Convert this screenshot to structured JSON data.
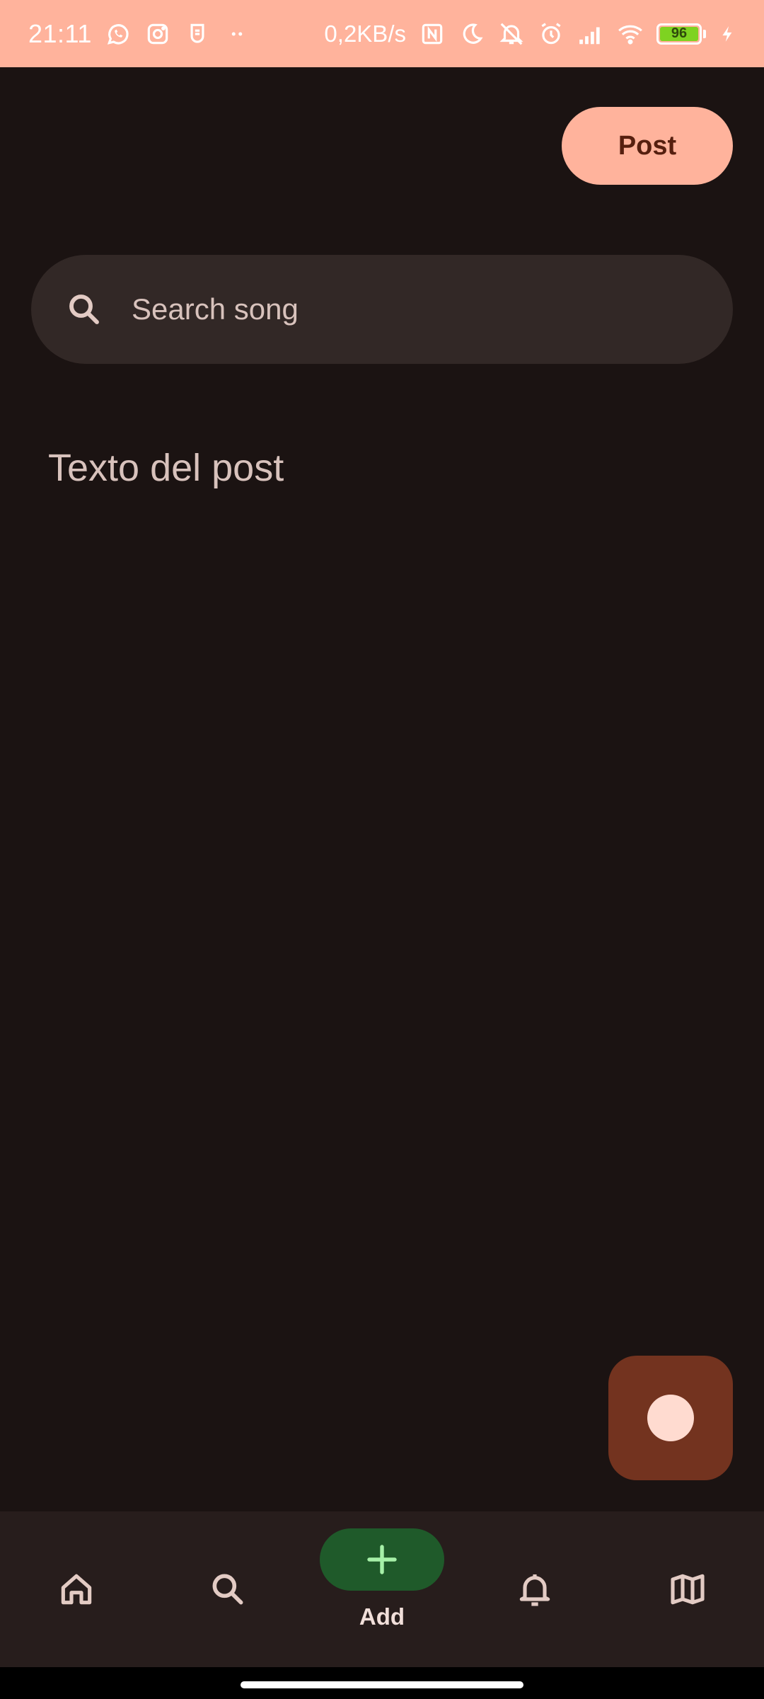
{
  "status_bar": {
    "time": "21:11",
    "network_speed": "0,2KB/s",
    "battery_level": "96",
    "background_color": "#ffb39c",
    "left_icons": [
      "whatsapp-icon",
      "instagram-icon",
      "app-icon",
      "more-dots-icon"
    ],
    "right_icons": [
      "nfc-icon",
      "moon-icon",
      "muted-bell-icon",
      "alarm-icon",
      "signal-icon",
      "wifi-icon",
      "battery-icon",
      "charging-icon"
    ]
  },
  "toolbar": {
    "post_label": "Post",
    "accent_color": "#ffb39c"
  },
  "search": {
    "placeholder": "Search song",
    "value": ""
  },
  "composer": {
    "placeholder": "Texto del post",
    "value": ""
  },
  "record_fab": {
    "icon": "record-icon",
    "color": "#73331f"
  },
  "bottom_nav": {
    "items": [
      {
        "id": "home",
        "icon": "home-icon",
        "label": ""
      },
      {
        "id": "search",
        "icon": "search-icon",
        "label": ""
      },
      {
        "id": "add",
        "icon": "plus-icon",
        "label": "Add",
        "selected": true
      },
      {
        "id": "notifications",
        "icon": "bell-icon",
        "label": ""
      },
      {
        "id": "map",
        "icon": "map-icon",
        "label": ""
      }
    ],
    "selected_color": "#1f5a2a"
  }
}
